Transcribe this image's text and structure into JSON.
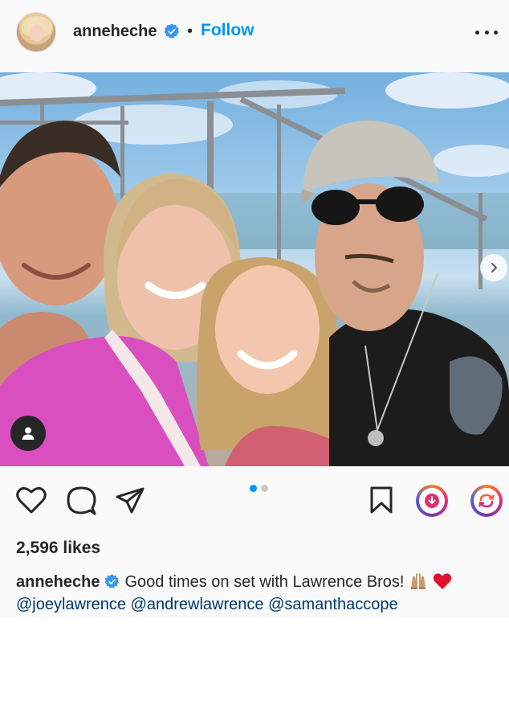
{
  "header": {
    "username": "anneheche",
    "separator": "•",
    "follow_label": "Follow"
  },
  "photo": {
    "carousel_total": 2,
    "carousel_active": 1
  },
  "stats": {
    "likes": "2,596 likes"
  },
  "caption": {
    "username": "anneheche",
    "text": "Good times on set with Lawrence Bros!",
    "mentions": [
      "@joeylawrence",
      "@andrewlawrence",
      "@samanthaccope"
    ]
  },
  "icons": {
    "verified": "verified-badge-icon",
    "more": "more-options-icon",
    "like": "heart-icon",
    "comment": "comment-icon",
    "share": "paper-plane-icon",
    "save": "bookmark-icon",
    "download": "download-icon",
    "repost": "repost-icon",
    "tagged": "user-tag-icon",
    "next": "chevron-right-icon"
  },
  "colors": {
    "accent": "#0095f6",
    "text": "#262626",
    "mention": "#00376b",
    "verified": "#3897f0"
  }
}
